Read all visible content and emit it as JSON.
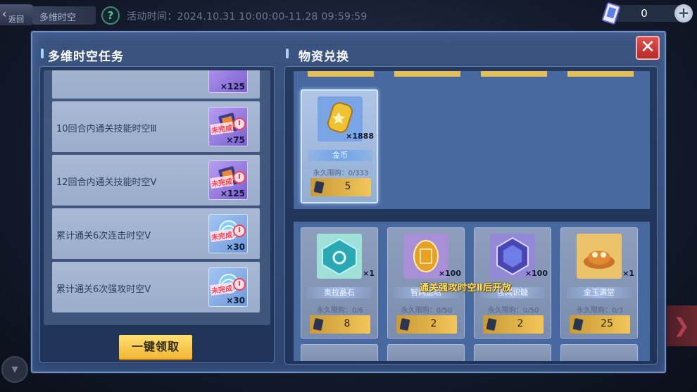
{
  "topbar": {
    "back_label": "返回",
    "title": "多维时空",
    "help_symbol": "?",
    "event_time": "活动时间：2024.10.31 10:00:00-11.28 09:59:59",
    "currency_value": "0",
    "plus_symbol": "+"
  },
  "tasks": {
    "title": "多维时空任务",
    "partial_top_qty": "×125",
    "items": [
      {
        "name": "10回合内通关技能时空Ⅲ",
        "qty": "×75",
        "status": "未完成",
        "reward_icon": "ticket-card-icon"
      },
      {
        "name": "12回合内通关技能时空Ⅴ",
        "qty": "×125",
        "status": "未完成",
        "reward_icon": "ticket-card-icon"
      },
      {
        "name": "累计通关6次连击时空Ⅴ",
        "qty": "×30",
        "status": "未完成",
        "reward_icon": "swirl-orb-icon"
      },
      {
        "name": "累计通关6次强攻时空Ⅴ",
        "qty": "×30",
        "status": "未完成",
        "reward_icon": "swirl-orb-icon"
      }
    ],
    "claim_all": "一键领取"
  },
  "shop": {
    "title": "物资兑换",
    "featured": {
      "name": "金币",
      "qty": "×1888",
      "limit": "永久限购：0/333",
      "price": "5",
      "icon": "gold-coin-icon"
    },
    "locked_text": "通关强攻时空Ⅱ后开放",
    "items": [
      {
        "name": "奥拉晶石",
        "qty": "×1",
        "limit": "永久限购：0/6",
        "price": "8",
        "icon": "crystal-cube-icon"
      },
      {
        "name": "智网遗珀",
        "qty": "×100",
        "limit": "永久限购：0/50",
        "price": "2",
        "icon": "amber-gem-icon"
      },
      {
        "name": "智网识髓",
        "qty": "×100",
        "limit": "永久限购：0/50",
        "price": "2",
        "icon": "hex-core-icon"
      },
      {
        "name": "金玉满堂",
        "qty": "×1",
        "limit": "永久限购：0/3",
        "price": "25",
        "icon": "feast-dish-icon"
      }
    ]
  },
  "colors": {
    "accent_gold": "#f2c65a",
    "status_red": "#ff4050",
    "panel_blue": "#2e4570"
  }
}
